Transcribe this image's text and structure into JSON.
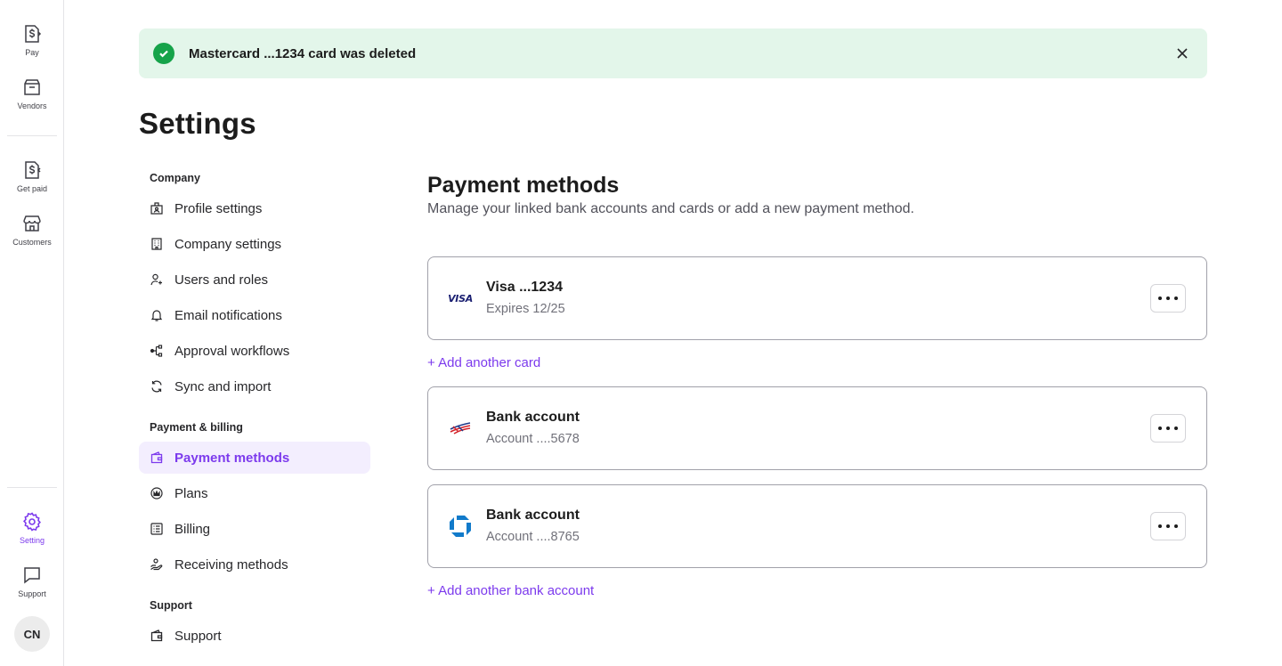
{
  "rail": {
    "items": [
      {
        "label": "Pay",
        "icon": "pay-icon"
      },
      {
        "label": "Vendors",
        "icon": "vendors-icon"
      },
      {
        "label": "Get paid",
        "icon": "get-paid-icon"
      },
      {
        "label": "Customers",
        "icon": "customers-icon"
      },
      {
        "label": "Setting",
        "icon": "gear-icon"
      },
      {
        "label": "Support",
        "icon": "chat-icon"
      }
    ],
    "avatar": "CN",
    "active_color": "#7c3aed"
  },
  "toast": {
    "message": "Mastercard ...1234 card was deleted",
    "color": "#e3f6ea"
  },
  "page": {
    "title": "Settings"
  },
  "nav": {
    "groups": [
      {
        "label": "Company",
        "items": [
          {
            "label": "Profile settings",
            "icon": "profile-icon"
          },
          {
            "label": "Company settings",
            "icon": "building-icon"
          },
          {
            "label": "Users and roles",
            "icon": "user-plus-icon"
          },
          {
            "label": "Email notifications",
            "icon": "bell-icon"
          },
          {
            "label": "Approval workflows",
            "icon": "workflow-icon"
          },
          {
            "label": "Sync and import",
            "icon": "sync-icon"
          }
        ]
      },
      {
        "label": "Payment & billing",
        "items": [
          {
            "label": "Payment methods",
            "icon": "wallet-icon",
            "active": true
          },
          {
            "label": "Plans",
            "icon": "plans-icon"
          },
          {
            "label": "Billing",
            "icon": "billing-icon"
          },
          {
            "label": "Receiving methods",
            "icon": "receiving-icon"
          }
        ]
      },
      {
        "label": "Support",
        "items": [
          {
            "label": "Support",
            "icon": "support-icon"
          }
        ]
      }
    ]
  },
  "main": {
    "title": "Payment methods",
    "subtitle": "Manage your linked bank accounts and cards or add a new payment method.",
    "cards": [
      {
        "title": "Visa ...1234",
        "subtitle": "Expires 12/25",
        "logo": "visa-logo",
        "logo_text": "VISA"
      },
      {
        "title": "Bank account",
        "subtitle": "Account ....5678",
        "logo": "bank-of-america-logo"
      },
      {
        "title": "Bank account",
        "subtitle": "Account ....8765",
        "logo": "chase-logo"
      }
    ],
    "add_card": "+ Add another card",
    "add_bank": "+ Add another bank account"
  }
}
